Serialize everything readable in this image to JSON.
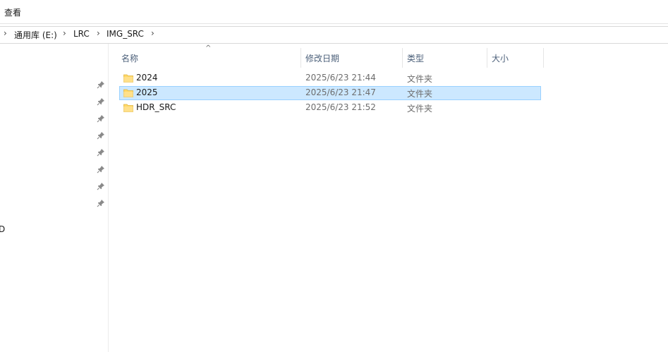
{
  "menu": {
    "view_label": "查看"
  },
  "address": {
    "crumbs": [
      "通用库 (E:)",
      "LRC",
      "IMG_SRC"
    ]
  },
  "nav": {
    "fragment_text": "D"
  },
  "columns": {
    "name": "名称",
    "modified": "修改日期",
    "type": "类型",
    "size": "大小",
    "sort_indicator": "^"
  },
  "files": [
    {
      "name": "2024",
      "modified": "2025/6/23 21:44",
      "type": "文件夹",
      "selected": false
    },
    {
      "name": "2025",
      "modified": "2025/6/23 21:47",
      "type": "文件夹",
      "selected": true
    },
    {
      "name": "HDR_SRC",
      "modified": "2025/6/23 21:52",
      "type": "文件夹",
      "selected": false
    }
  ],
  "colors": {
    "selection_fill": "#cce8ff",
    "selection_border": "#99d1ff",
    "folder_fill": "#ffd866",
    "header_text": "#4c607a"
  }
}
